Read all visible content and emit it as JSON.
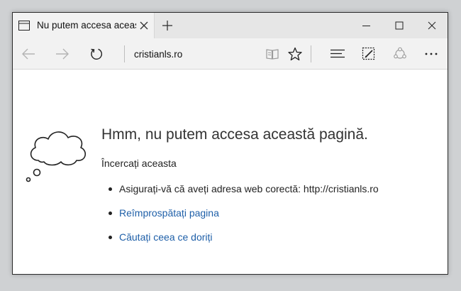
{
  "tab": {
    "title": "Nu putem accesa aceas",
    "icon": "page-icon"
  },
  "window_controls": [
    "minimize-icon",
    "maximize-icon",
    "close-icon"
  ],
  "nav": {
    "address": "cristianls.ro",
    "buttons": [
      "back-arrow-icon",
      "forward-arrow-icon",
      "refresh-icon"
    ],
    "tools": [
      "reading-view-icon",
      "favorites-star-icon",
      "hub-icon",
      "web-note-icon",
      "share-icon",
      "more-icon"
    ]
  },
  "error": {
    "heading": "Hmm, nu putem accesa această pagină.",
    "subheading": "Încercați aceasta",
    "items": [
      {
        "text": "Asigurați-vă că aveți adresa web corectă: http://cristianls.ro",
        "link": false
      },
      {
        "text": "Reîmprospătați pagina",
        "link": true
      },
      {
        "text": "Căutați ceea ce doriți",
        "link": true
      }
    ]
  },
  "colors": {
    "link": "#1e5fa8",
    "chrome": "#f2f2f2",
    "tabbar": "#e6e6e6"
  }
}
